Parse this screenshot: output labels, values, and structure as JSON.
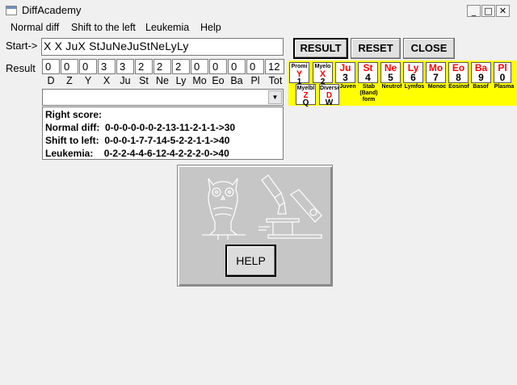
{
  "window": {
    "title": "DiffAcademy",
    "minimize": "_",
    "maximize": "□",
    "close": "✕"
  },
  "menu": {
    "items": [
      "Normal diff",
      "Shift to the left",
      "Leukemia",
      "Help"
    ]
  },
  "start": {
    "label": "Start->",
    "value": "X X JuX StJuNeJuStNeLyLy"
  },
  "result": {
    "label": "Result",
    "values": [
      "0",
      "0",
      "0",
      "3",
      "3",
      "2",
      "2",
      "2",
      "0",
      "0",
      "0",
      "0",
      "12"
    ],
    "codes": [
      "D",
      "Z",
      "Y",
      "X",
      "Ju",
      "St",
      "Ne",
      "Ly",
      "Mo",
      "Eo",
      "Ba",
      "Pl",
      "Tot"
    ]
  },
  "combo": {
    "value": ""
  },
  "score": {
    "heading": "Right score:",
    "normal": "Normal diff:  0-0-0-0-0-0-2-13-11-2-1-1->30",
    "shift": "Shift to left:  0-0-0-1-7-7-14-5-2-2-1-1->40",
    "leukemia": "Leukemia:    0-2-2-4-4-6-12-4-2-2-2-0->40"
  },
  "buttons": {
    "result": "RESULT",
    "reset": "RESET",
    "close": "CLOSE",
    "help": "HELP"
  },
  "palette": {
    "row1": [
      {
        "name": "Promi",
        "code": "Y",
        "key": "1"
      },
      {
        "name": "Myelo",
        "code": "X",
        "key": "2"
      },
      {
        "code": "Ju",
        "key": "3"
      },
      {
        "code": "St",
        "key": "4"
      },
      {
        "code": "Ne",
        "key": "5"
      },
      {
        "code": "Ly",
        "key": "6"
      },
      {
        "code": "Mo",
        "key": "7"
      },
      {
        "code": "Eo",
        "key": "8"
      },
      {
        "code": "Ba",
        "key": "9"
      },
      {
        "code": "Pl",
        "key": "0"
      }
    ],
    "captions": [
      "Juven",
      "Stab (Band) form",
      "Neutrof",
      "Lymfos",
      "Monoc",
      "Eosinof",
      "Basof",
      "Plasma"
    ],
    "row2": [
      {
        "name": "Myelbl",
        "code": "Z",
        "key": "Q"
      },
      {
        "name": "Diverse",
        "code": "D",
        "key": "W"
      }
    ]
  },
  "colors": {
    "palette_bg": "#ffff00",
    "code_red": "#ff0000",
    "panel_grey": "#c6c6c6"
  },
  "icons": [
    "owl-icon",
    "microscope-icon"
  ]
}
